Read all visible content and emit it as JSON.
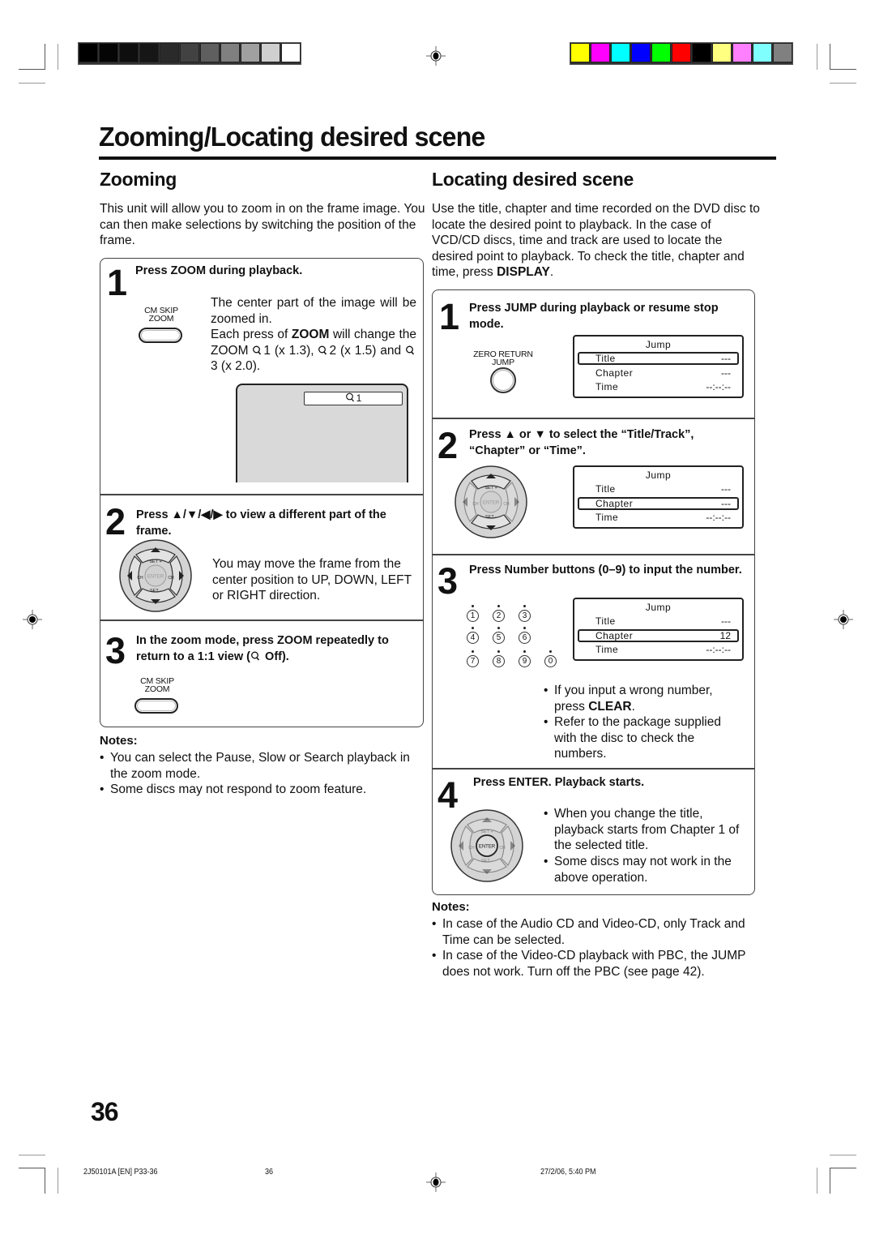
{
  "print_marks": {
    "gray_scale_swatches": [
      "#000000",
      "#050505",
      "#0e0e0e",
      "#161616",
      "#2a2a2a",
      "#424242",
      "#5f5f5f",
      "#808080",
      "#a0a0a0",
      "#cfcfcf",
      "#ffffff"
    ],
    "color_swatches": [
      "#ffff00",
      "#ff00ff",
      "#00ffff",
      "#0000ff",
      "#00ff00",
      "#ff0000",
      "#000000",
      "#ffff80",
      "#ff80ff",
      "#80ffff",
      "#808080"
    ]
  },
  "page_title": "Zooming/Locating desired scene",
  "zooming": {
    "title": "Zooming",
    "intro": "This unit will allow you to zoom in on the frame image. You can then make selections by switching the position of the frame.",
    "step1": {
      "number": "1",
      "heading": "Press ZOOM during playback.",
      "button_label_line1": "CM SKIP",
      "button_label_line2": "ZOOM",
      "text_a": "The center part of the image will be zoomed in.",
      "text_b_pre": "Each press of ",
      "text_b_bold": "ZOOM",
      "text_b_post": " will change the ZOOM ",
      "zoom1": "1 (x 1.3), ",
      "zoom2": "2 (x 1.5) and ",
      "zoom3": "3 (x 2.0).",
      "screen_osd": "1"
    },
    "step2": {
      "number": "2",
      "heading": "Press ▲/▼/◀/▶ to view a different part of the frame.",
      "text": "You may move the frame from the center position to UP, DOWN, LEFT or RIGHT direction.",
      "pad_labels": {
        "set_plus": "SET +",
        "set_minus": "SET -",
        "enter": "ENTER",
        "ch": "CH"
      }
    },
    "step3": {
      "number": "3",
      "heading_pre": "In the zoom mode, press ZOOM repeatedly to return to a 1:1 view (",
      "heading_post": " Off).",
      "button_label_line1": "CM SKIP",
      "button_label_line2": "ZOOM"
    },
    "notes": {
      "title": "Notes:",
      "items": [
        "You can select the Pause, Slow or Search playback in the zoom mode.",
        "Some discs may not respond to zoom feature."
      ]
    }
  },
  "locating": {
    "title": "Locating desired scene",
    "intro_pre": "Use the title, chapter and time recorded on the DVD disc to locate the desired point to playback. In the case of VCD/CD discs, time and track are used to locate the desired point to playback. To check the title, chapter and time, press ",
    "intro_bold": "DISPLAY",
    "intro_post": ".",
    "step1": {
      "number": "1",
      "heading": "Press JUMP during playback or resume stop mode.",
      "button_label_line1": "ZERO RETURN",
      "button_label_line2": "JUMP",
      "osd": {
        "header": "Jump",
        "rows": [
          {
            "label": "Title",
            "value": "---",
            "selected": true
          },
          {
            "label": "Chapter",
            "value": "---",
            "selected": false
          },
          {
            "label": "Time",
            "value": "--:--:--",
            "selected": false
          }
        ]
      }
    },
    "step2": {
      "number": "2",
      "heading": "Press ▲ or ▼ to select the “Title/Track”, “Chapter” or “Time”.",
      "osd": {
        "header": "Jump",
        "rows": [
          {
            "label": "Title",
            "value": "---",
            "selected": false
          },
          {
            "label": "Chapter",
            "value": "---",
            "selected": true
          },
          {
            "label": "Time",
            "value": "--:--:--",
            "selected": false
          }
        ]
      }
    },
    "step3": {
      "number": "3",
      "heading": "Press Number buttons (0–9) to input the number.",
      "number_keys": [
        "1",
        "2",
        "3",
        "4",
        "5",
        "6",
        "7",
        "8",
        "9",
        "0"
      ],
      "osd": {
        "header": "Jump",
        "rows": [
          {
            "label": "Title",
            "value": "---",
            "selected": false
          },
          {
            "label": "Chapter",
            "value": "12",
            "selected": true
          },
          {
            "label": "Time",
            "value": "--:--:--",
            "selected": false
          }
        ]
      },
      "bullet1_pre": "If you input a wrong number, press ",
      "bullet1_bold": "CLEAR",
      "bullet1_post": ".",
      "bullet2": "Refer to the package supplied with the disc to check the numbers."
    },
    "step4": {
      "number": "4",
      "heading": "Press ENTER. Playback starts.",
      "bullets": [
        "When you change the title, playback starts from Chapter 1 of the selected title.",
        "Some discs may not work in the above operation."
      ]
    },
    "notes": {
      "title": "Notes:",
      "items": [
        "In case of the Audio CD and Video-CD, only Track and Time can be selected.",
        "In case of the Video-CD playback with PBC, the JUMP does not work. Turn off the PBC (see page 42)."
      ]
    }
  },
  "page_number": "36",
  "footer": {
    "job": "2J50101A [EN] P33-36",
    "page": "36",
    "timestamp": "27/2/06, 5:40 PM"
  }
}
